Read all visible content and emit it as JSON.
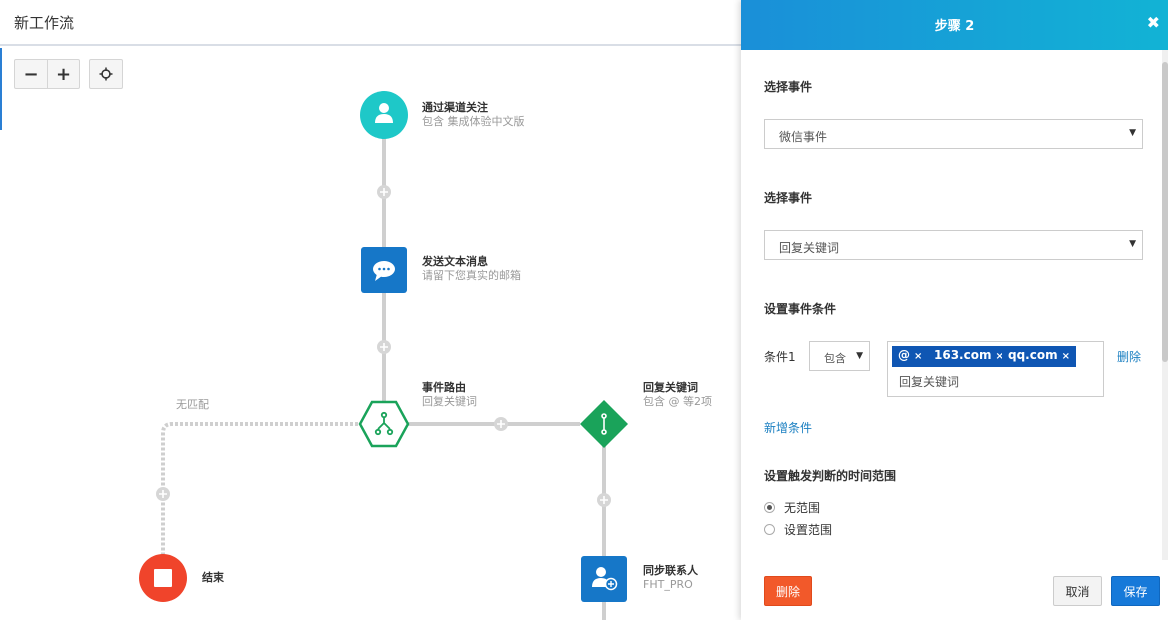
{
  "header": {
    "title": "新工作流"
  },
  "toolbar": {
    "zoom_out": "−",
    "zoom_in": "+",
    "center": "⌖"
  },
  "flow": {
    "nodes": [
      {
        "id": "n1",
        "title": "通过渠道关注",
        "subtitle": "包含 集成体验中文版"
      },
      {
        "id": "n2",
        "title": "发送文本消息",
        "subtitle": "请留下您真实的邮箱"
      },
      {
        "id": "n3",
        "title": "事件路由",
        "subtitle": "回复关键词"
      },
      {
        "id": "n4",
        "title": "回复关键词",
        "subtitle": "包含 @ 等2项"
      },
      {
        "id": "n5",
        "title": "同步联系人",
        "subtitle": "FHT_PRO"
      },
      {
        "id": "n6",
        "title": "结束",
        "subtitle": ""
      }
    ],
    "no_match_label": "无匹配",
    "colors": {
      "teal": "#1ec8c8",
      "blue": "#1677c8",
      "green": "#1aa35a",
      "red": "#f0442b",
      "line": "#cfcfcf"
    }
  },
  "panel": {
    "title": "步骤 2",
    "close": "✖",
    "section1_label": "选择事件",
    "select1_value": "微信事件",
    "section2_label": "选择事件",
    "select2_value": "回复关键词",
    "section3_label": "设置事件条件",
    "condition_label": "条件1",
    "condition_op": "包含",
    "tags": [
      "@",
      "163.com",
      "qq.com"
    ],
    "tag_remove": "×",
    "tag_input_value": "回复关键词",
    "delete_condition": "删除",
    "add_condition": "新增条件",
    "section4_label": "设置触发判断的时间范围",
    "radio_options": [
      {
        "label": "无范围",
        "selected": true
      },
      {
        "label": "设置范围",
        "selected": false
      }
    ],
    "buttons": {
      "delete": "删除",
      "cancel": "取消",
      "save": "保存"
    },
    "arrow": "▼"
  }
}
